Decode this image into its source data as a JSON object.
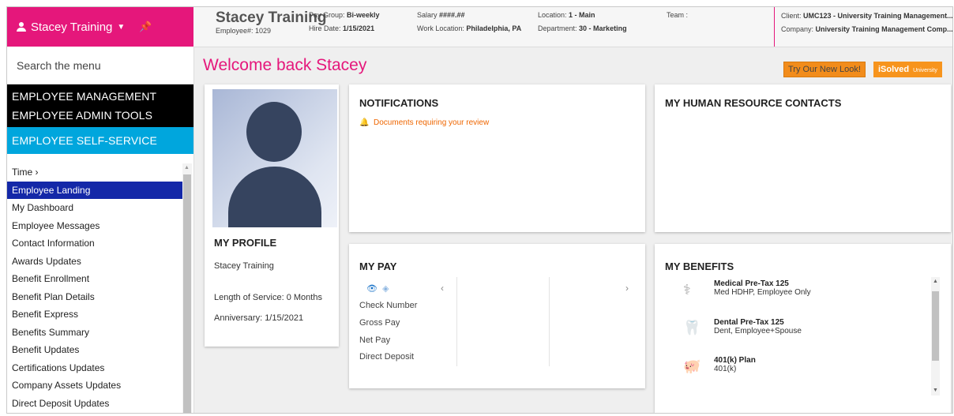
{
  "brand": {
    "user_label": "Stacey Training"
  },
  "header": {
    "name": "Stacey Training",
    "employee_number": "Employee#: 1029",
    "pay_group_label": "Pay Group:",
    "pay_group": "Bi-weekly",
    "hire_date_label": "Hire Date:",
    "hire_date": "1/15/2021",
    "salary_label": "Salary",
    "salary": "####.##",
    "work_location_label": "Work Location:",
    "work_location": "Philadelphia, PA",
    "location_label": "Location:",
    "location": "1 - Main",
    "department_label": "Department:",
    "department": "30 - Marketing",
    "team_label": "Team :",
    "client_label": "Client:",
    "client": "UMC123 - University Training Management...",
    "company_label": "Company:",
    "company": "University Training Management Comp..."
  },
  "sidebar": {
    "search_placeholder": "Search the menu",
    "sections": [
      "EMPLOYEE MANAGEMENT",
      "EMPLOYEE ADMIN TOOLS",
      "EMPLOYEE SELF-SERVICE"
    ],
    "items": [
      "Time  ›",
      "Employee Landing",
      "My Dashboard",
      "Employee Messages",
      "Contact Information",
      "Awards Updates",
      "Benefit Enrollment",
      "Benefit Plan Details",
      "Benefit Express",
      "Benefits Summary",
      "Benefit Updates",
      "Certifications Updates",
      "Company Assets Updates",
      "Direct Deposit Updates"
    ],
    "active_item": "Employee Landing"
  },
  "main": {
    "welcome": "Welcome back Stacey",
    "try_new_look": "Try Our New Look!",
    "isolved_label": "iSolved",
    "isolved_sub": "University"
  },
  "profile": {
    "title": "MY PROFILE",
    "name": "Stacey Training",
    "length_of_service": "Length of Service: 0 Months",
    "anniversary": "Anniversary: 1/15/2021"
  },
  "notifications": {
    "title": "NOTIFICATIONS",
    "alert": "Documents requiring your review"
  },
  "hr_contacts": {
    "title": "MY HUMAN RESOURCE CONTACTS"
  },
  "pay": {
    "title": "MY PAY",
    "rows": [
      "Check Number",
      "Gross Pay",
      "Net Pay",
      "Direct Deposit"
    ]
  },
  "benefits": {
    "title": "MY BENEFITS",
    "items": [
      {
        "name": "Medical Pre-Tax 125",
        "detail": "Med HDHP, Employee Only",
        "icon": "caduceus-icon"
      },
      {
        "name": "Dental Pre-Tax 125",
        "detail": "Dent, Employee+Spouse",
        "icon": "tooth-icon"
      },
      {
        "name": "401(k) Plan",
        "detail": "401(k)",
        "icon": "piggy-bank-icon"
      }
    ]
  },
  "colors": {
    "brand_pink": "#e5177b",
    "self_service_blue": "#00a6dd",
    "active_navy": "#1428a8",
    "accent_orange": "#f28c1b"
  }
}
